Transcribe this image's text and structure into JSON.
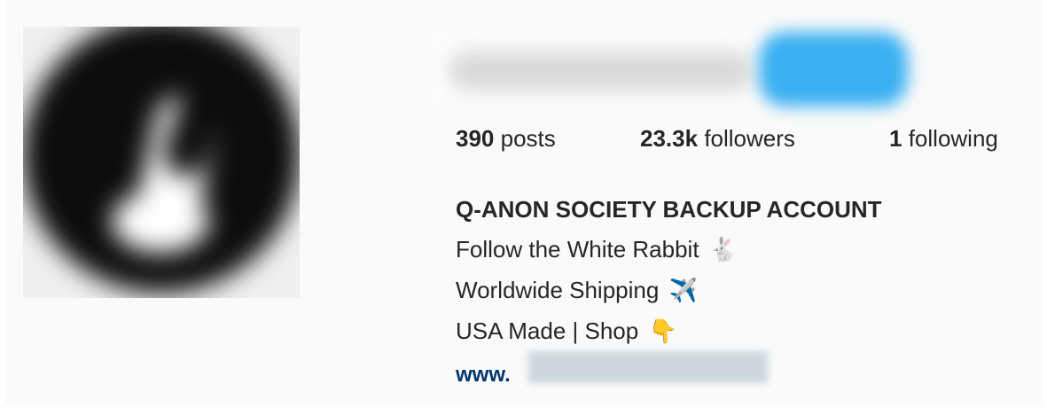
{
  "profile": {
    "stats": {
      "posts_count": "390",
      "posts_label": "posts",
      "followers_count": "23.3k",
      "followers_label": "followers",
      "following_count": "1",
      "following_label": "following"
    },
    "bio": {
      "name": "Q-ANON SOCIETY BACKUP ACCOUNT",
      "lines": [
        {
          "text": "Follow the White Rabbit",
          "emoji": "🐇"
        },
        {
          "text": "Worldwide Shipping",
          "emoji": "✈️"
        },
        {
          "text": "USA Made | Shop",
          "emoji": "👇"
        }
      ],
      "link_prefix": "www."
    }
  },
  "colors": {
    "follow_button": "#3ab0f2",
    "link": "#00376b",
    "background": "#fafafa"
  }
}
